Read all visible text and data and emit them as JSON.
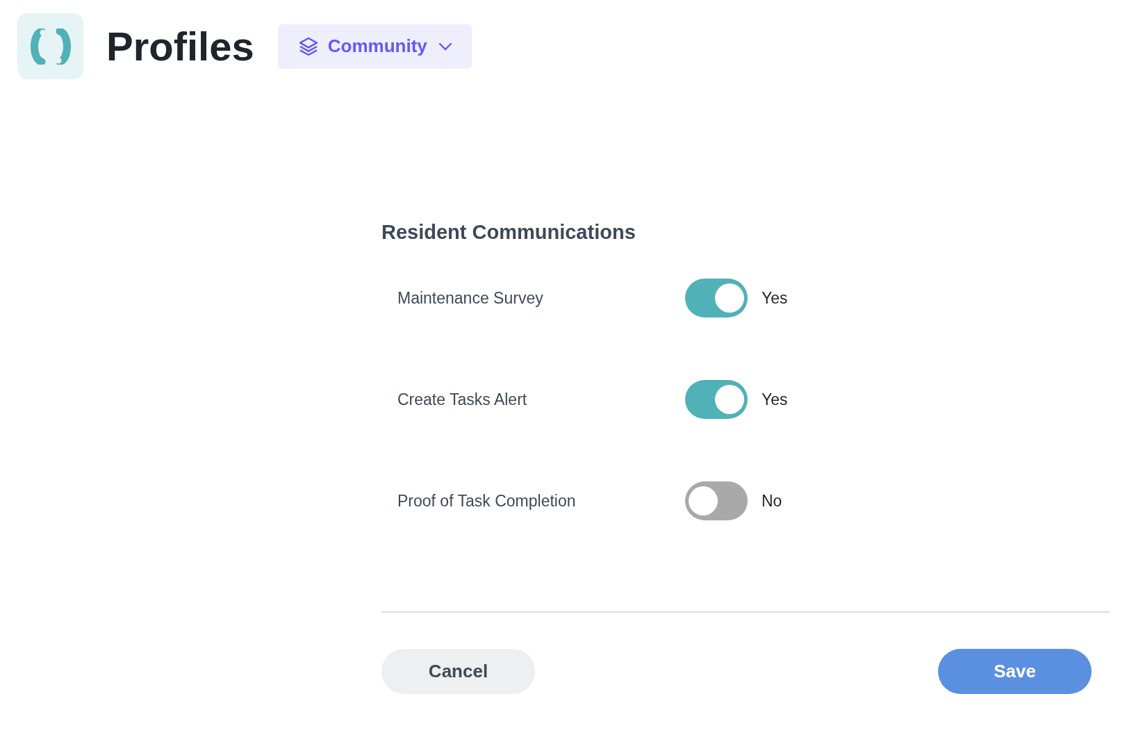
{
  "header": {
    "title": "Profiles",
    "scope": {
      "label": "Community"
    }
  },
  "section": {
    "title": "Resident Communications",
    "settings": [
      {
        "label": "Maintenance Survey",
        "on": true,
        "state_label": "Yes"
      },
      {
        "label": "Create Tasks Alert",
        "on": true,
        "state_label": "Yes"
      },
      {
        "label": "Proof of Task Completion",
        "on": false,
        "state_label": "No"
      }
    ]
  },
  "buttons": [
    {
      "label": "Cancel",
      "kind": "secondary"
    },
    {
      "label": "Save",
      "kind": "primary"
    }
  ]
}
